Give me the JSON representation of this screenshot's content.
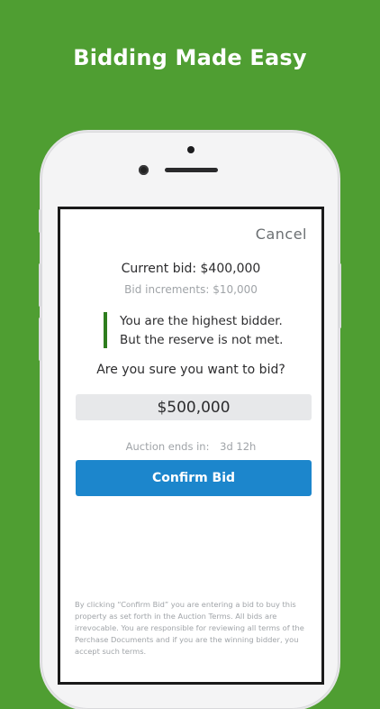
{
  "headline": "Bidding Made Easy",
  "dialog": {
    "cancel_label": "Cancel",
    "current_bid": "Current bid: $400,000",
    "bid_increments": "Bid increments: $10,000",
    "notice_line1": "You are the highest bidder.",
    "notice_line2": "But the reserve is not met.",
    "question": "Are you sure you want to bid?",
    "bid_amount": "$500,000",
    "auction_ends_label": "Auction ends in:",
    "auction_ends_value": "3d 12h",
    "confirm_label": "Confirm Bid",
    "legal_text": "By clicking “Confirm Bid” you are entering  a bid to buy this property as set forth in the Auction Terms. All bids are irrevocable. You are responsible  for reviewing all terms of the Perchase Documents and if you are the winning bidder, you accept such terms."
  },
  "colors": {
    "background": "#4f9e32",
    "accent_blue": "#1c86cc",
    "notice_bar": "#2e7d1e"
  }
}
